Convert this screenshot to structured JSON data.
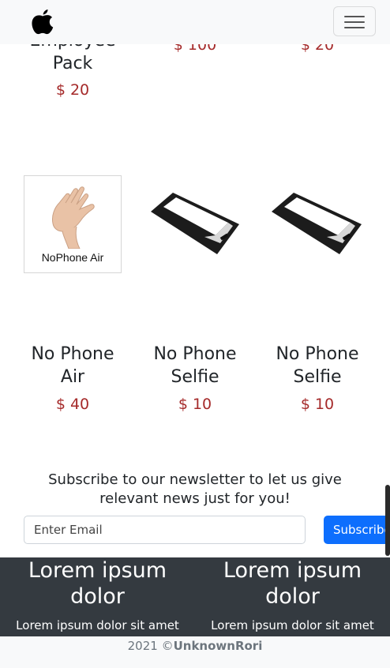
{
  "navbar": {
    "logo_icon": "apple-logo-icon",
    "menu_icon": "hamburger-menu-icon"
  },
  "products_top": [
    {
      "name_line2": "Employee",
      "name_line3": "Pack",
      "price": "$ 20"
    },
    {
      "price": "$ 100"
    },
    {
      "price": "$ 20"
    }
  ],
  "products": [
    {
      "name_line1": "No Phone",
      "name_line2": "Air",
      "price": "$ 40",
      "image_caption": "NoPhone Air",
      "image_icon": "hand-holding-phone-icon"
    },
    {
      "name_line1": "No Phone",
      "name_line2": "Selfie",
      "price": "$ 10",
      "image_icon": "phone-icon"
    },
    {
      "name_line1": "No Phone",
      "name_line2": "Selfie",
      "price": "$ 10",
      "image_icon": "phone-icon"
    }
  ],
  "newsletter": {
    "text_line1": "Subscribe to our newsletter to let us give",
    "text_line2": "relevant news just for you!",
    "email_placeholder": "Enter Email",
    "button_label": "Subscribe"
  },
  "footer": {
    "columns": [
      {
        "title_line1": "Lorem ipsum",
        "title_line2": "dolor",
        "text": "Lorem ipsum dolor sit amet"
      },
      {
        "title_line1": "Lorem ipsum",
        "title_line2": "dolor",
        "text": "Lorem ipsum dolor sit amet"
      }
    ],
    "copyright_prefix": "2021 ©",
    "copyright_author": "UnknownRori"
  },
  "colors": {
    "price": "#a52a2a",
    "accent": "#0d6efd",
    "footer_bg": "#343a40"
  }
}
